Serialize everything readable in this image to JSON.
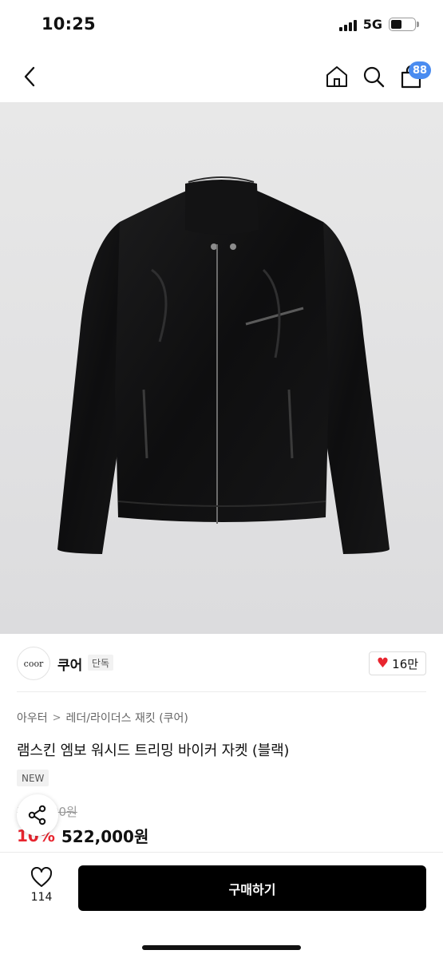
{
  "status_bar": {
    "time": "10:25",
    "network": "5G"
  },
  "nav": {
    "cart_count": "88"
  },
  "brand": {
    "logo_text": "coor",
    "name": "쿠어",
    "tag": "단독",
    "likes": "16만"
  },
  "breadcrumb": {
    "category": "아우터",
    "subcategory": "레더/라이더스 재킷 (쿠어)"
  },
  "product": {
    "title": "램스킨 엠보 워시드 트리밍 바이커 자켓 (블랙)",
    "badge": "NEW",
    "original_price": "580,000원",
    "discount": "10%",
    "sale_price": "522,000원"
  },
  "bottom_bar": {
    "wish_count": "114",
    "buy_label": "구매하기"
  },
  "colors": {
    "accent_red": "#e8252f",
    "badge_blue": "#4a8cf0",
    "buy_button": "#000000"
  },
  "icons": [
    "back-icon",
    "home-icon",
    "search-icon",
    "cart-icon",
    "heart-icon",
    "share-icon"
  ]
}
